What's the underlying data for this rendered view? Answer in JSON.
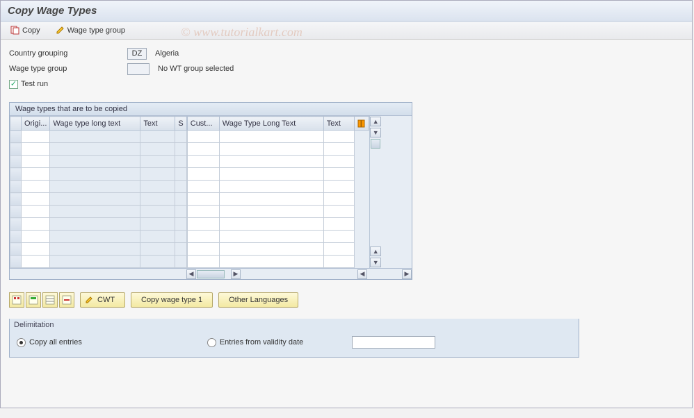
{
  "page": {
    "title": "Copy Wage Types"
  },
  "toolbar": {
    "copy_label": "Copy",
    "wtgroup_label": "Wage type group"
  },
  "watermark": "©   www.tutorialkart.com",
  "form": {
    "country_grouping_label": "Country grouping",
    "country_grouping_value": "DZ",
    "country_grouping_desc": "Algeria",
    "wage_type_group_label": "Wage type group",
    "wage_type_group_value": "",
    "wage_type_group_desc": "No WT group selected",
    "test_run_label": "Test run",
    "test_run_checked": true
  },
  "table": {
    "title": "Wage types that are to be copied",
    "columns_left": [
      "Origi...",
      "Wage type long text",
      "Text",
      "S"
    ],
    "columns_right": [
      "Cust...",
      "Wage Type Long Text",
      "Text"
    ],
    "row_count": 11
  },
  "buttons": {
    "cwt_label": "CWT",
    "copy_wt1_label": "Copy wage type 1",
    "other_lang_label": "Other Languages"
  },
  "delimitation": {
    "title": "Delimitation",
    "copy_all_label": "Copy all entries",
    "from_date_label": "Entries from validity date",
    "selected": "copy_all",
    "date_value": ""
  }
}
